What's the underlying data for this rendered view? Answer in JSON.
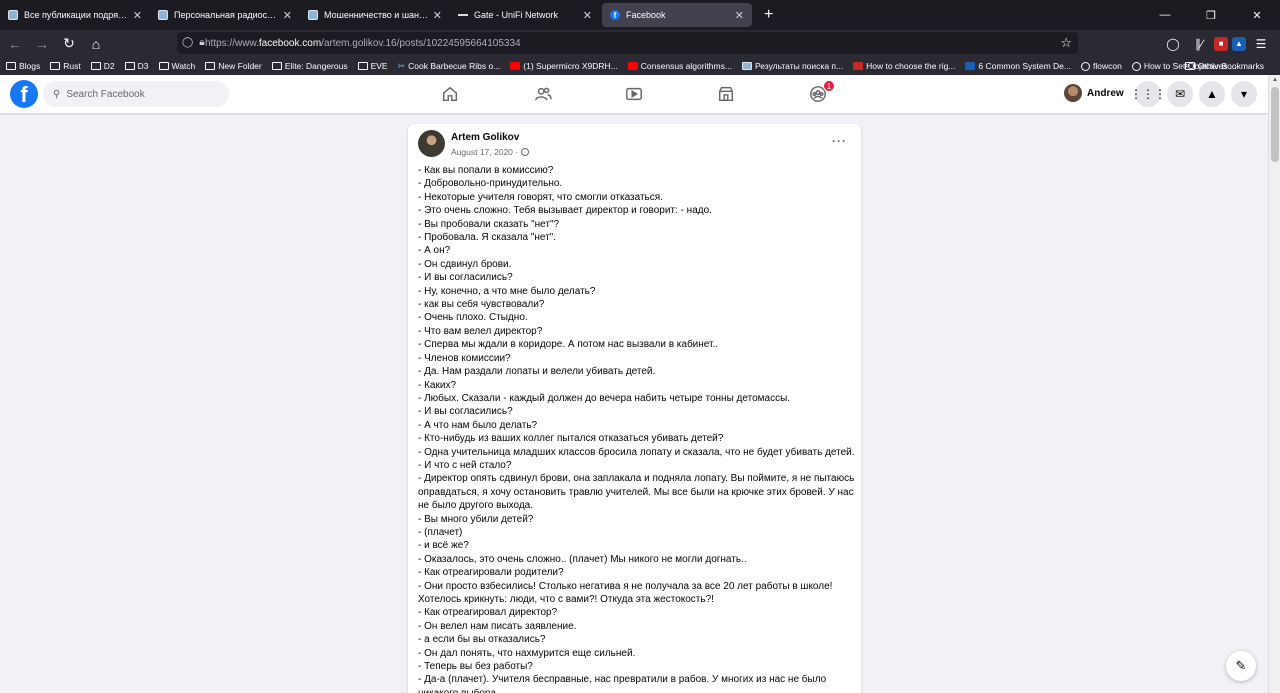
{
  "browser": {
    "tabs": [
      {
        "title": "Все публикации подряд / Хабр",
        "icon": "habr-icon",
        "active": false
      },
      {
        "title": "Персональная радиосвязь. Чт",
        "icon": "habr-icon",
        "active": false
      },
      {
        "title": "Мошенничество и шантаж: пр",
        "icon": "habr-icon",
        "active": false
      },
      {
        "title": "Gate - UniFi Network",
        "icon": "unifi-icon",
        "active": false
      },
      {
        "title": "Facebook",
        "icon": "facebook-icon",
        "active": true
      }
    ],
    "new_tab_label": "+",
    "url_prefix": "https://www.",
    "url_host": "facebook.com",
    "url_path": "/artem.golikov.16/posts/10224595664105334",
    "bookmarks": [
      {
        "label": "Blogs",
        "icon": "folder"
      },
      {
        "label": "Rust",
        "icon": "folder"
      },
      {
        "label": "D2",
        "icon": "folder"
      },
      {
        "label": "D3",
        "icon": "folder"
      },
      {
        "label": "Watch",
        "icon": "folder"
      },
      {
        "label": "New Folder",
        "icon": "folder"
      },
      {
        "label": "Elite: Dangerous",
        "icon": "folder"
      },
      {
        "label": "EVE",
        "icon": "folder"
      },
      {
        "label": "Cook Barbecue Ribs o...",
        "icon": "cross"
      },
      {
        "label": "(1) Supermicro X9DRH...",
        "icon": "yt"
      },
      {
        "label": "Consensus algorithms...",
        "icon": "yt"
      },
      {
        "label": "Результаты поиска п...",
        "icon": "habr"
      },
      {
        "label": "How to choose the rig...",
        "icon": "iw"
      },
      {
        "label": "6 Common System De...",
        "icon": "blue"
      },
      {
        "label": "flowcon",
        "icon": "globe"
      },
      {
        "label": "How to Set Objectives ...",
        "icon": "globe"
      }
    ],
    "other_bookmarks": "Other Bookmarks"
  },
  "facebook": {
    "search_placeholder": "Search Facebook",
    "groups_badge": "1",
    "user_name": "Andrew"
  },
  "post": {
    "author": "Artem Golikov",
    "date": "August 17, 2020 ·",
    "lines": [
      "- Как вы попали в комиссию?",
      "- Добровольно-принудительно.",
      "- Некоторые учителя говорят, что смогли отказаться.",
      "- Это очень сложно. Тебя вызывает директор и говорит: - надо.",
      "- Вы пробовали сказать \"нет\"?",
      "- Пробовала. Я сказала \"нет\".",
      "- А он?",
      "- Он сдвинул брови.",
      "- И вы согласились?",
      "- Ну, конечно, а что мне было делать?",
      "- как вы себя чувствовали?",
      "- Очень плохо. Стыдно.",
      "- Что вам велел директор?",
      "- Сперва мы ждали в коридоре. А потом нас вызвали в кабинет..",
      "- Членов комиссии?",
      "- Да. Нам раздали лопаты и велели убивать детей.",
      "- Каких?",
      "- Любых. Сказали - каждый должен до вечера набить четыре тонны детомассы.",
      "- И вы согласились?",
      "- А что нам было делать?",
      "- Кто-нибудь из ваших коллег пытался отказаться убивать детей?",
      "- Одна учительница младших классов бросила лопату и сказала, что не будет убивать детей.",
      "- И что с ней стало?",
      "- Директор опять сдвинул брови, она заплакала и подняла лопату. Вы поймите, я не пытаюсь оправдаться, я хочу остановить травлю учителей. Мы все были на крючке этих бровей. У нас не было другого выхода.",
      "- Вы много убили детей?",
      "- (плачет)",
      "- и всё же?",
      "- Оказалось, это очень сложно.. (плачет) Мы никого не могли догнать..",
      "- Как отреагировали родители?",
      "- Они просто взбесились! Столько негатива я не получала за все 20 лет работы в школе! Хотелось крикнуть: люди, что с вами?! Откуда эта жестокость?!",
      "- Как отреагировал директор?",
      "- Он велел нам писать заявление.",
      "- а если бы вы отказались?",
      "- Он дал понять, что нахмурится еще сильней.",
      "- Теперь вы без работы?",
      "- Да-а (плачет). Учителя бесправные, нас превратили в рабов. У многих из нас не было никакого выбора."
    ]
  }
}
